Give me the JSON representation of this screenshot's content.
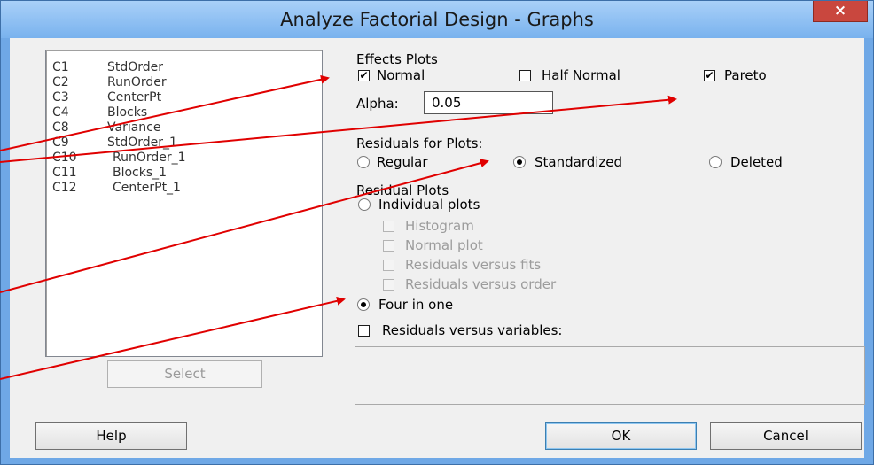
{
  "window": {
    "title": "Analyze Factorial Design - Graphs",
    "close_label": "×"
  },
  "variables": [
    {
      "id": "C1",
      "name": "StdOrder"
    },
    {
      "id": "C2",
      "name": "RunOrder"
    },
    {
      "id": "C3",
      "name": "CenterPt"
    },
    {
      "id": "C4",
      "name": "Blocks"
    },
    {
      "id": "C8",
      "name": "Variance"
    },
    {
      "id": "C9",
      "name": "StdOrder_1"
    },
    {
      "id": "C10",
      "name": "RunOrder_1"
    },
    {
      "id": "C11",
      "name": "Blocks_1"
    },
    {
      "id": "C12",
      "name": "CenterPt_1"
    }
  ],
  "select_label": "Select",
  "effects": {
    "heading": "Effects Plots",
    "normal": {
      "label": "Normal",
      "checked": true
    },
    "half_normal": {
      "label": "Half Normal",
      "checked": false
    },
    "pareto": {
      "label": "Pareto",
      "checked": true
    },
    "alpha_label": "Alpha:",
    "alpha_value": "0.05"
  },
  "residuals_for_plots": {
    "heading": "Residuals for Plots:",
    "options": [
      "Regular",
      "Standardized",
      "Deleted"
    ],
    "selected": "Standardized"
  },
  "residual_plots": {
    "heading": "Residual Plots",
    "individual": "Individual plots",
    "histogram": "Histogram",
    "normal_plot": "Normal plot",
    "vs_fits": "Residuals versus fits",
    "vs_order": "Residuals versus order",
    "four_in_one": "Four in one",
    "selected": "Four in one"
  },
  "residuals_vs_variables": {
    "label": "Residuals versus variables:",
    "checked": false
  },
  "buttons": {
    "help": "Help",
    "ok": "OK",
    "cancel": "Cancel"
  },
  "colors": {
    "annotation_arrow": "#e00000",
    "titlebar": "#8ec0f3",
    "dialog_bg": "#f0f0f0"
  }
}
